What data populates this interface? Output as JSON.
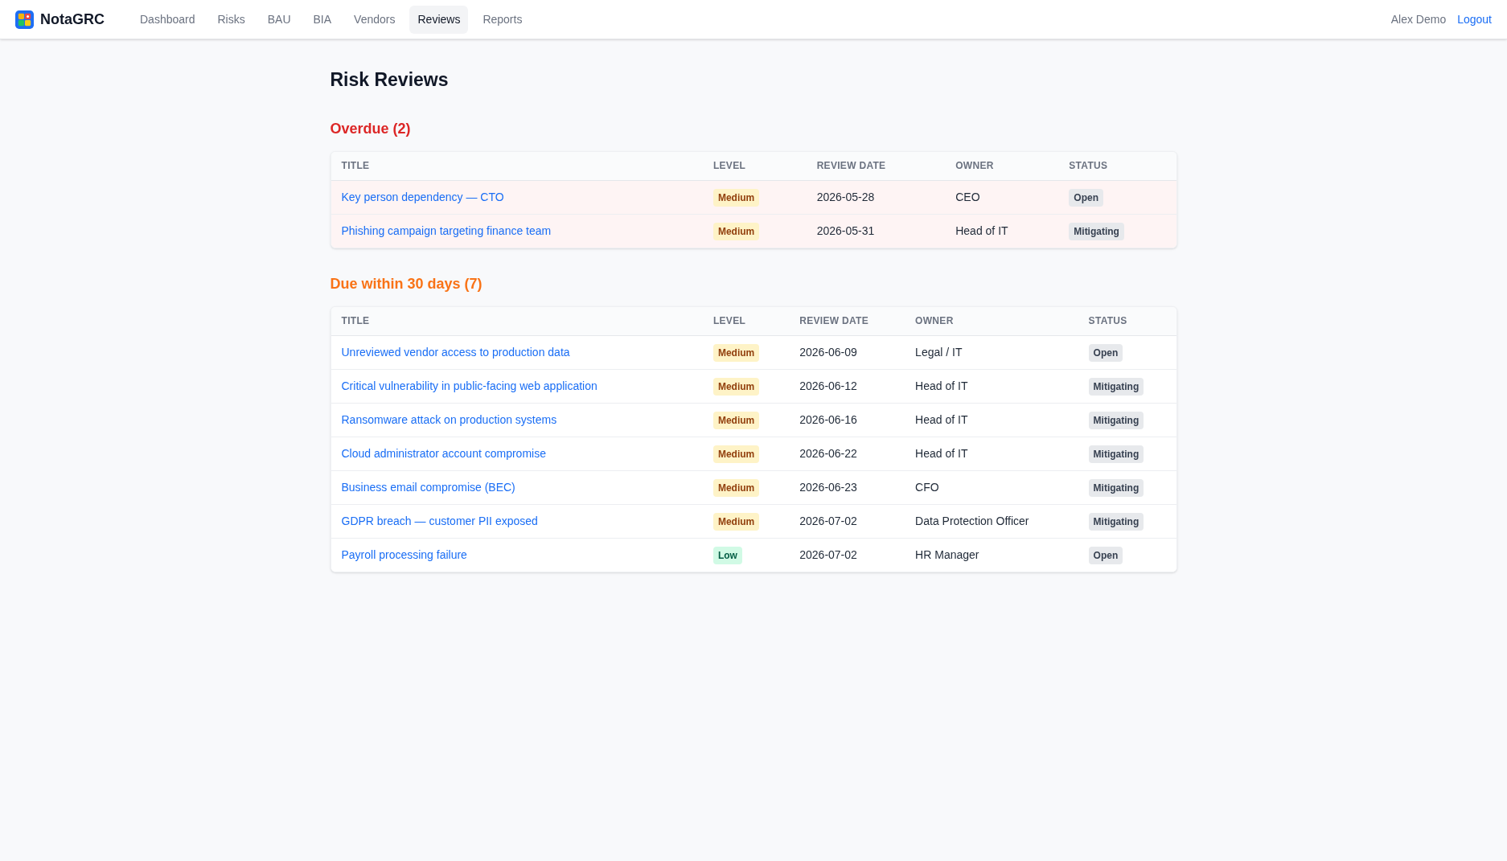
{
  "nav": {
    "brand": "NotaGRC",
    "items": [
      {
        "label": "Dashboard",
        "selected": false
      },
      {
        "label": "Risks",
        "selected": false
      },
      {
        "label": "BAU",
        "selected": false
      },
      {
        "label": "BIA",
        "selected": false
      },
      {
        "label": "Vendors",
        "selected": false
      },
      {
        "label": "Reviews",
        "selected": true
      },
      {
        "label": "Reports",
        "selected": false
      }
    ],
    "user": "Alex Demo",
    "logout": "Logout"
  },
  "page_title": "Risk Reviews",
  "sections": [
    {
      "kind": "overdue",
      "heading": "Overdue (2)",
      "columns": [
        "TITLE",
        "LEVEL",
        "REVIEW DATE",
        "OWNER",
        "STATUS"
      ],
      "rows": [
        {
          "title": "Key person dependency — CTO",
          "level_badge": {
            "label": "Medium",
            "kind": "medium"
          },
          "review_date": "2026-05-28",
          "owner": "CEO",
          "status": "Open"
        },
        {
          "title": "Phishing campaign targeting finance team",
          "level_badge": {
            "label": "Medium",
            "kind": "medium"
          },
          "review_date": "2026-05-31",
          "owner": "Head of IT",
          "status": "Mitigating"
        }
      ]
    },
    {
      "kind": "upcoming",
      "heading": "Due within 30 days (7)",
      "columns": [
        "TITLE",
        "LEVEL",
        "REVIEW DATE",
        "OWNER",
        "STATUS"
      ],
      "rows": [
        {
          "title": "Unreviewed vendor access to production data",
          "level_badge": {
            "label": "Medium",
            "kind": "medium"
          },
          "review_date": "2026-06-09",
          "owner": "Legal / IT",
          "status": "Open"
        },
        {
          "title": "Critical vulnerability in public-facing web application",
          "level_badge": {
            "label": "Medium",
            "kind": "medium"
          },
          "review_date": "2026-06-12",
          "owner": "Head of IT",
          "status": "Mitigating"
        },
        {
          "title": "Ransomware attack on production systems",
          "level_badge": {
            "label": "Medium",
            "kind": "medium"
          },
          "review_date": "2026-06-16",
          "owner": "Head of IT",
          "status": "Mitigating"
        },
        {
          "title": "Cloud administrator account compromise",
          "level_badge": {
            "label": "Medium",
            "kind": "medium"
          },
          "review_date": "2026-06-22",
          "owner": "Head of IT",
          "status": "Mitigating"
        },
        {
          "title": "Business email compromise (BEC)",
          "level_badge": {
            "label": "Medium",
            "kind": "medium"
          },
          "review_date": "2026-06-23",
          "owner": "CFO",
          "status": "Mitigating"
        },
        {
          "title": "GDPR breach — customer PII exposed",
          "level_badge": {
            "label": "Medium",
            "kind": "medium"
          },
          "review_date": "2026-07-02",
          "owner": "Data Protection Officer",
          "status": "Mitigating"
        },
        {
          "title": "Payroll processing failure",
          "level_badge": {
            "label": "Low",
            "kind": "low"
          },
          "review_date": "2026-07-02",
          "owner": "HR Manager",
          "status": "Open"
        }
      ]
    }
  ]
}
